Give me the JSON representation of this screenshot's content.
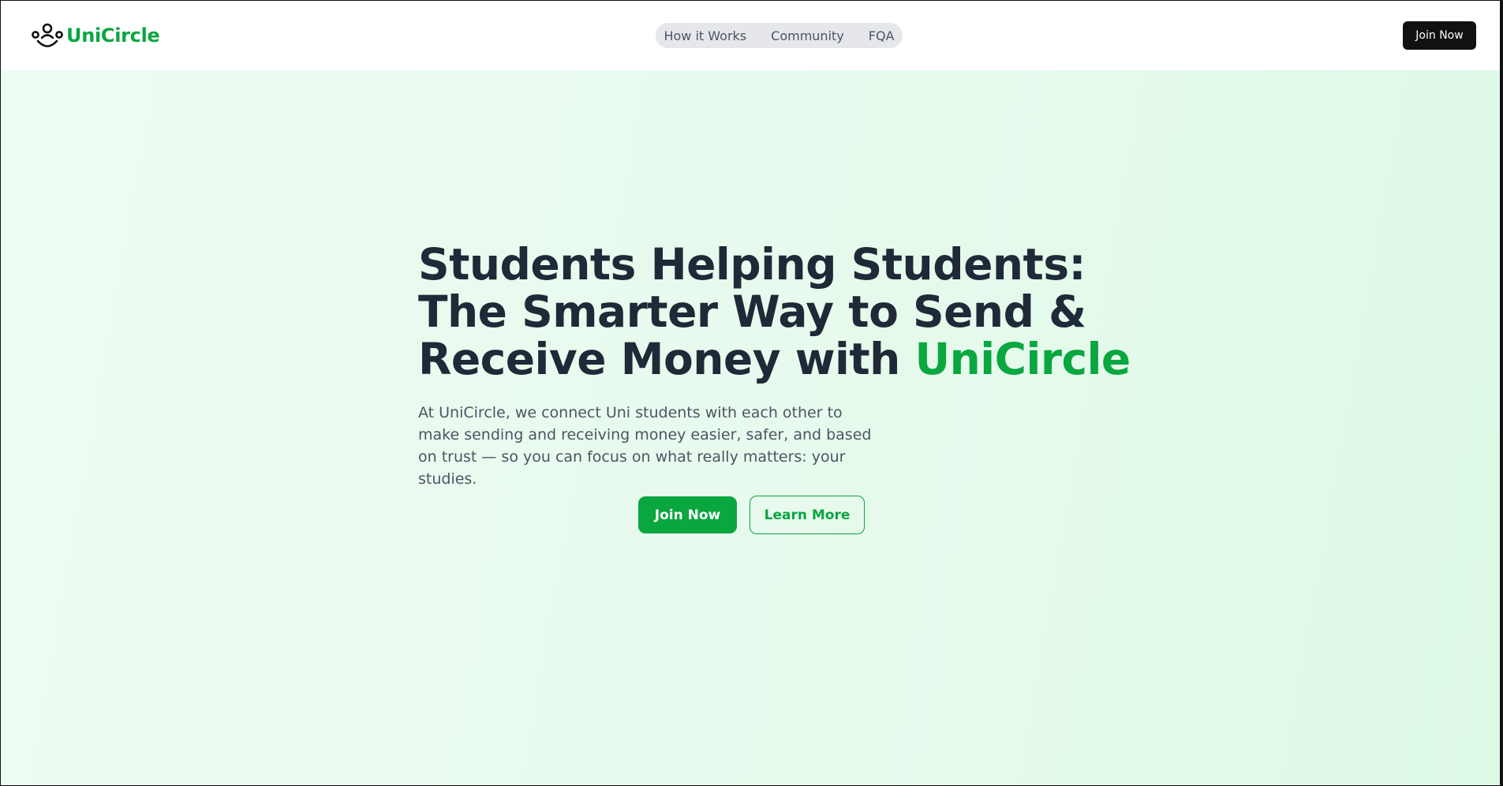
{
  "brand": {
    "name": "UniCircle",
    "logo_icon": "people-circle-icon",
    "color": "#0aa640"
  },
  "nav": {
    "items": [
      {
        "label": "How it Works"
      },
      {
        "label": "Community"
      },
      {
        "label": "FQA"
      }
    ]
  },
  "header": {
    "join_label": "Join Now"
  },
  "hero": {
    "title_line1": "Students Helping Students:",
    "title_line2": "The Smarter Way to Send &",
    "title_line3_prefix": "Receive Money with ",
    "title_line3_accent": "UniCircle",
    "description": "At UniCircle, we connect Uni students with each other to make sending and receiving money easier, safer, and based on trust — so you can focus on what really matters: your studies.",
    "primary_cta": "Join Now",
    "secondary_cta": "Learn More"
  },
  "colors": {
    "accent": "#0aa640",
    "heading": "#1f2937",
    "body_text": "#4b5563",
    "dark_button": "#111111",
    "hero_background": "#e6faec"
  }
}
